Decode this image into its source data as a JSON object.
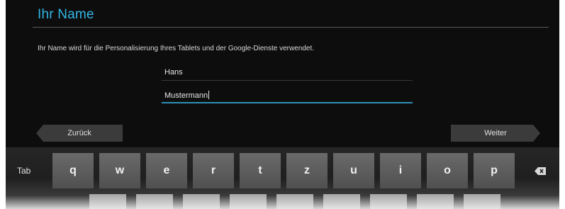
{
  "header": {
    "title": "Ihr Name"
  },
  "description": "Ihr Name wird für die Personalisierung Ihres Tablets und der Google-Dienste verwendet.",
  "form": {
    "first_name": "Hans",
    "last_name": "Mustermann"
  },
  "nav": {
    "back_label": "Zurück",
    "next_label": "Weiter"
  },
  "keyboard": {
    "tab_label": "Tab",
    "keys": [
      "q",
      "w",
      "e",
      "r",
      "t",
      "z",
      "u",
      "i",
      "o",
      "p"
    ],
    "backspace_icon": "backspace-icon"
  },
  "colors": {
    "accent": "#33b5e5",
    "background": "#0d0d0d"
  }
}
